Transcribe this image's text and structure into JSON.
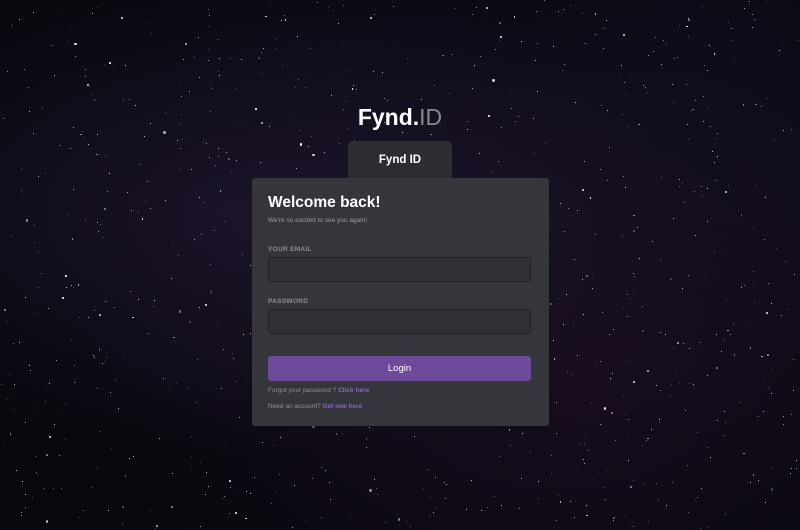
{
  "logo": {
    "main": "Fynd.",
    "sub": "ID"
  },
  "tab": {
    "label": "Fynd ID"
  },
  "card": {
    "title": "Welcome back!",
    "subtitle": "We're so excited to see you again!",
    "email_label": "YOUR EMAIL",
    "email_value": "",
    "password_label": "PASSWORD",
    "password_value": "",
    "login_button": "Login",
    "forgot_text": "Forgot your password ?",
    "forgot_link": "Click here",
    "account_text": "Need an account?",
    "account_link": "Get one here"
  },
  "colors": {
    "background": "#08070d",
    "card": "#35363b",
    "tab": "#2c2d31",
    "accent": "#6d4b9a",
    "link": "#8a63c7"
  }
}
